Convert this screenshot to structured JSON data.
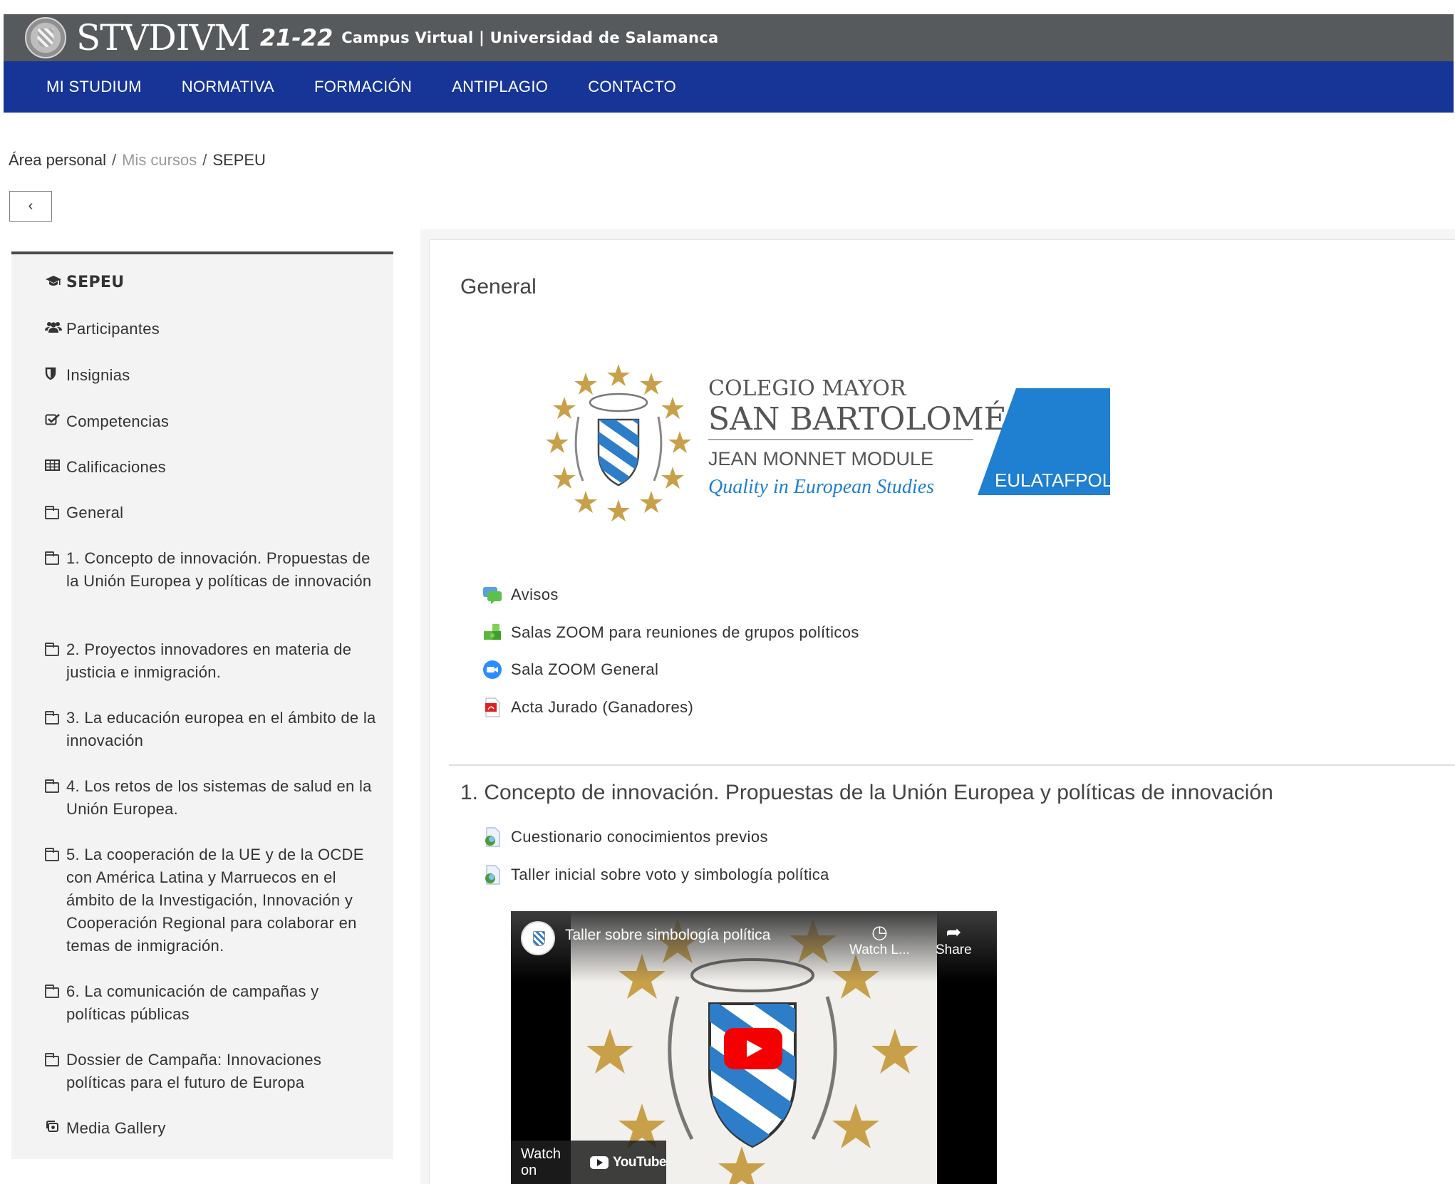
{
  "brand": {
    "wordmark": "STVDIVM",
    "year": "21-22",
    "subtitle": "Campus Virtual | Universidad de Salamanca"
  },
  "nav": {
    "items": [
      {
        "label": "MI STUDIUM"
      },
      {
        "label": "NORMATIVA"
      },
      {
        "label": "FORMACIÓN"
      },
      {
        "label": "ANTIPLAGIO"
      },
      {
        "label": "CONTACTO"
      }
    ]
  },
  "breadcrumb": {
    "items": [
      "Área personal",
      "Mis cursos",
      "SEPEU"
    ],
    "separator": "/"
  },
  "back_button": {
    "label": "‹"
  },
  "sidebar": {
    "items": [
      {
        "label": "SEPEU",
        "icon": "graduation-cap-icon"
      },
      {
        "label": "Participantes",
        "icon": "users-icon"
      },
      {
        "label": "Insignias",
        "icon": "shield-icon"
      },
      {
        "label": "Competencias",
        "icon": "checkbox-icon"
      },
      {
        "label": "Calificaciones",
        "icon": "table-icon"
      },
      {
        "label": "General",
        "icon": "folder-icon"
      },
      {
        "label": "1. Concepto de innovación. Propuestas de la Unión Europea y políticas de innovación",
        "icon": "folder-icon"
      },
      {
        "label": "2. Proyectos innovadores en materia de justicia e inmigración.",
        "icon": "folder-icon"
      },
      {
        "label": "3. La educación europea en el ámbito de la innovación",
        "icon": "folder-icon"
      },
      {
        "label": "4. Los retos de los sistemas de salud en la Unión Europea.",
        "icon": "folder-icon"
      },
      {
        "label": "5. La cooperación de la UE y de la OCDE con América Latina y Marruecos en el ámbito de la Investigación, Innovación y Cooperación Regional para colaborar en temas de inmigración.",
        "icon": "folder-icon"
      },
      {
        "label": "6. La comunicación de campañas y políticas públicas",
        "icon": "folder-icon"
      },
      {
        "label": "Dossier de Campaña: Innovaciones políticas para el futuro de Europa",
        "icon": "folder-icon"
      },
      {
        "label": "Media Gallery",
        "icon": "gallery-icon"
      }
    ]
  },
  "main": {
    "general_title": "General",
    "logo": {
      "line1": "COLEGIO MAYOR",
      "line2": "SAN BARTOLOMÉ",
      "line3": "JEAN MONNET MODULE",
      "line4": "Quality in European Studies",
      "badge": "EULATAFPOL"
    },
    "general_activities": [
      {
        "label": "Avisos",
        "icon": "forum-icon"
      },
      {
        "label": "Salas ZOOM para reuniones de grupos políticos",
        "icon": "puzzle-icon"
      },
      {
        "label": "Sala ZOOM General",
        "icon": "zoom-camera-icon"
      },
      {
        "label": "Acta Jurado (Ganadores)",
        "icon": "pdf-icon"
      }
    ],
    "section1_title": "1. Concepto de innovación. Propuestas de la Unión Europea y políticas de innovación",
    "section1_activities": [
      {
        "label": "Cuestionario conocimientos previos",
        "icon": "feedback-icon"
      },
      {
        "label": "Taller inicial sobre voto y simbología política",
        "icon": "feedback-icon"
      }
    ],
    "video": {
      "title": "Taller sobre simbología política",
      "watch_later": "Watch L...",
      "share": "Share",
      "watch_on": "Watch on",
      "youtube": "YouTube"
    }
  },
  "colors": {
    "brandbar": "#575a5d",
    "navbar": "#163596",
    "sidebar_bg": "#f3f3f3",
    "logo_blue": "#1f7fd0",
    "star_gold": "#c9a04a",
    "play_red": "#f40000"
  }
}
